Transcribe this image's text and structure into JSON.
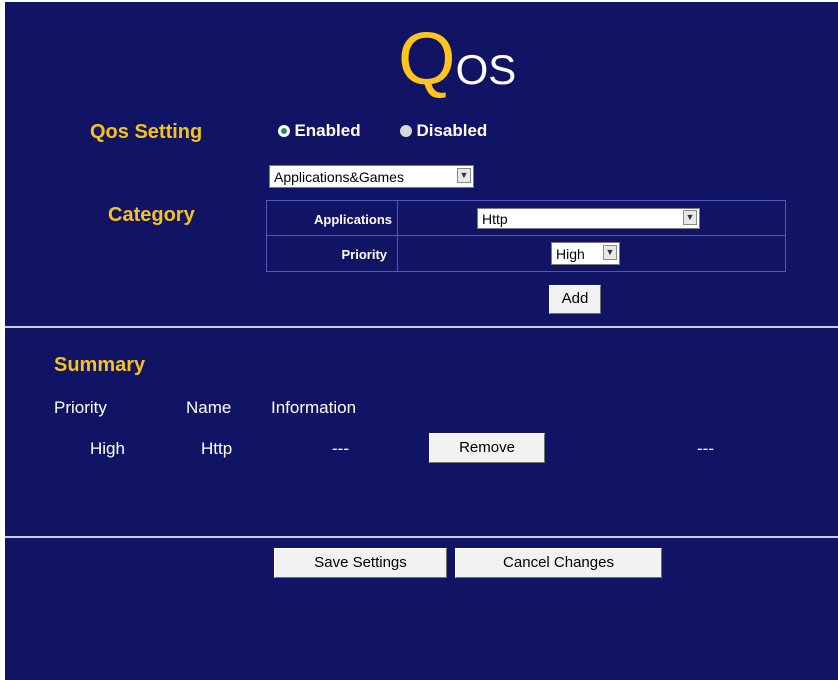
{
  "header": {
    "title_initial": "Q",
    "title_rest": "OS"
  },
  "qos_setting": {
    "label": "Qos Setting",
    "enabled_label": "Enabled",
    "disabled_label": "Disabled",
    "selected": "Enabled"
  },
  "category": {
    "label": "Category",
    "type_select": "Applications&Games",
    "applications_label": "Applications",
    "applications_value": "Http",
    "priority_label": "Priority",
    "priority_value": "High",
    "add_button": "Add"
  },
  "summary": {
    "title": "Summary",
    "headers": {
      "priority": "Priority",
      "name": "Name",
      "information": "Information"
    },
    "rows": [
      {
        "priority": "High",
        "name": "Http",
        "information": "---",
        "remove_label": "Remove",
        "extra": "---"
      }
    ]
  },
  "actions": {
    "save": "Save Settings",
    "cancel": "Cancel Changes"
  },
  "colors": {
    "background": "#111464",
    "accent": "#f7c21b",
    "divider": "#c8cce8"
  }
}
